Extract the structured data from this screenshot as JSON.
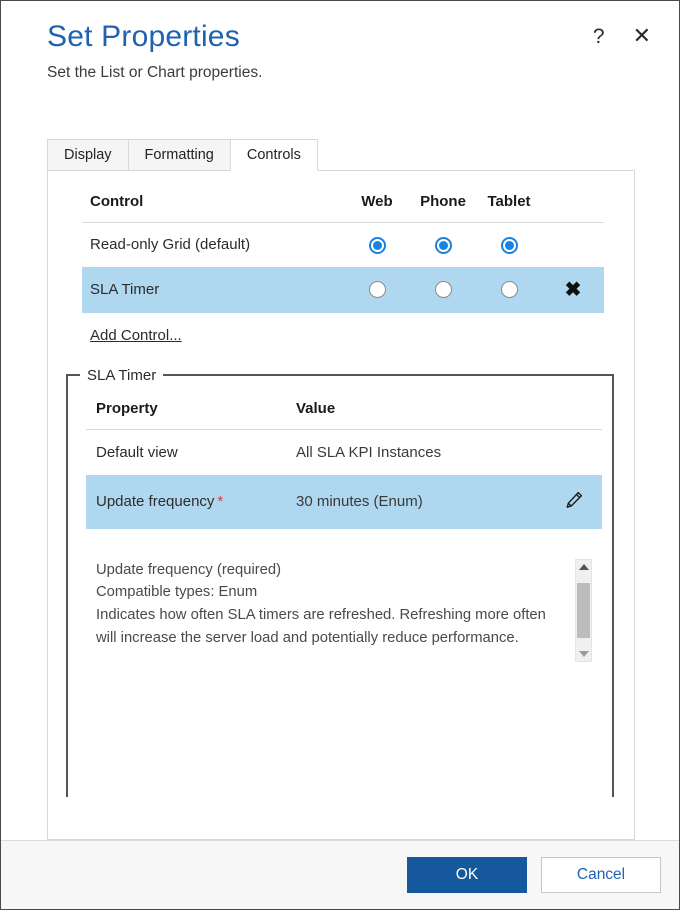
{
  "header": {
    "title": "Set Properties",
    "subtitle": "Set the List or Chart properties.",
    "help_icon": "?",
    "close_icon": "✕"
  },
  "tabs": [
    {
      "label": "Display",
      "active": false
    },
    {
      "label": "Formatting",
      "active": false
    },
    {
      "label": "Controls",
      "active": true
    }
  ],
  "controls_table": {
    "headers": {
      "control": "Control",
      "web": "Web",
      "phone": "Phone",
      "tablet": "Tablet"
    },
    "rows": [
      {
        "name": "Read-only Grid (default)",
        "web": true,
        "phone": true,
        "tablet": true,
        "selected": false,
        "removable": false
      },
      {
        "name": "SLA Timer",
        "web": false,
        "phone": false,
        "tablet": false,
        "selected": true,
        "removable": true,
        "remove_icon": "✖"
      }
    ],
    "add_link": "Add Control..."
  },
  "properties_panel": {
    "legend": "SLA Timer",
    "headers": {
      "property": "Property",
      "value": "Value"
    },
    "rows": [
      {
        "property": "Default view",
        "required": false,
        "value": "All SLA KPI Instances",
        "selected": false,
        "editable": false
      },
      {
        "property": "Update frequency",
        "required": true,
        "required_marker": "*",
        "value": "30 minutes (Enum)",
        "selected": true,
        "editable": true
      }
    ],
    "description": {
      "line1": "Update frequency (required)",
      "line2": "Compatible types: Enum",
      "line3": "Indicates how often SLA timers are refreshed. Refreshing more often will increase the server load and potentially reduce performance."
    }
  },
  "footer": {
    "ok_label": "OK",
    "cancel_label": "Cancel"
  },
  "colors": {
    "title_blue": "#1f62b0",
    "primary_button": "#15599c",
    "selection_highlight": "#afd7ef",
    "radio_accent": "#1683e2",
    "required_star": "#e03a3a"
  }
}
